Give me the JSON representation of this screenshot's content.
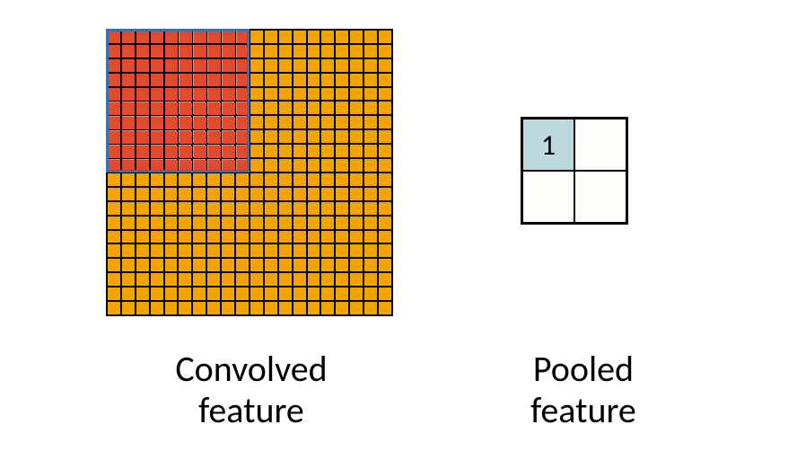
{
  "convolved": {
    "label": "Convolved\nfeature",
    "grid_size": 20,
    "cell_color": "#f4a300",
    "region": {
      "size": 10,
      "cell_color": "#e24a2b",
      "border_color": "#3e6fa6"
    }
  },
  "pooled": {
    "label": "Pooled\nfeature",
    "grid_size": 2,
    "cells": [
      {
        "value": "1",
        "highlight": true
      },
      {
        "value": "",
        "highlight": false
      },
      {
        "value": "",
        "highlight": false
      },
      {
        "value": "",
        "highlight": false
      }
    ]
  }
}
